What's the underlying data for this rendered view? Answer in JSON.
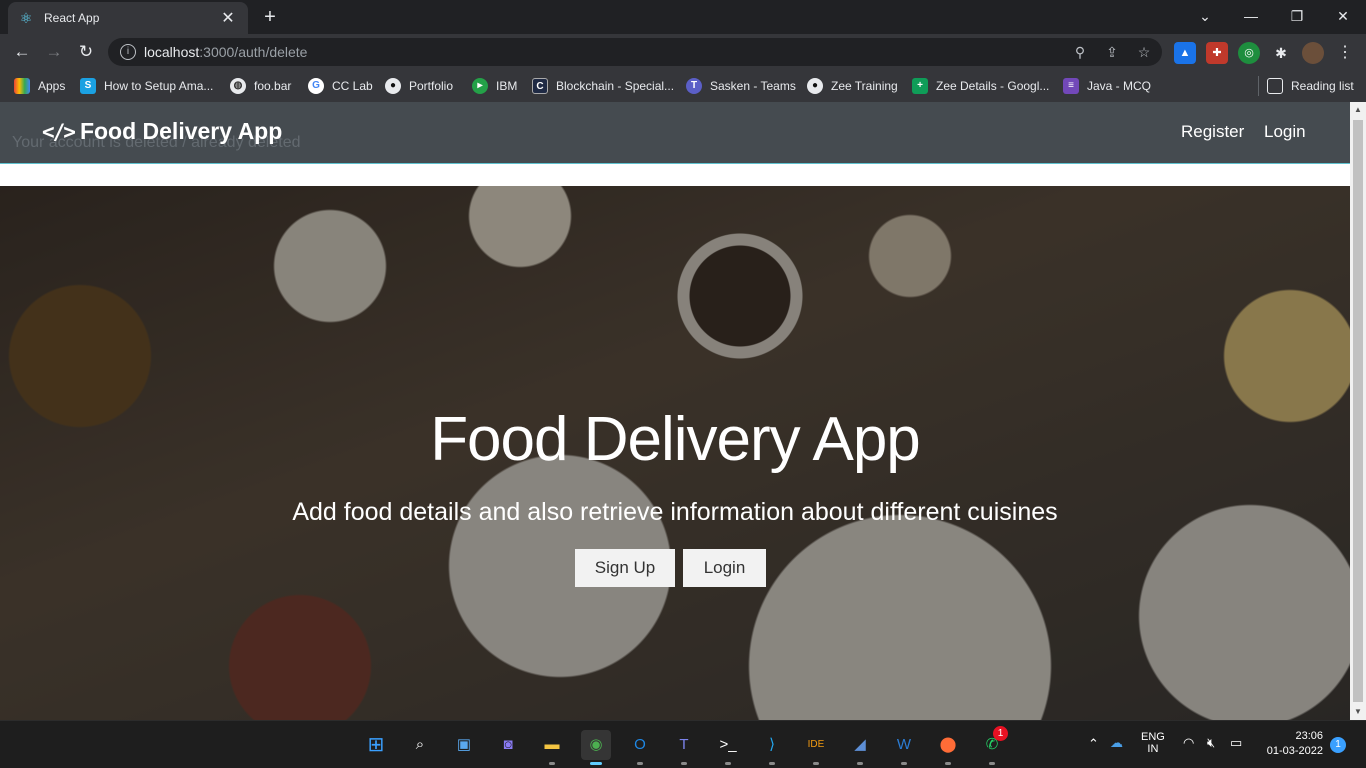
{
  "browser": {
    "tab_title": "React App",
    "url_host": "localhost",
    "url_path": ":3000/auth/delete",
    "bookmarks": [
      {
        "label": "Apps",
        "icon": "apps-grid-icon"
      },
      {
        "label": "How to Setup Ama...",
        "icon": "s-icon"
      },
      {
        "label": "foo.bar",
        "icon": "globe-icon"
      },
      {
        "label": "CC Lab",
        "icon": "google-icon"
      },
      {
        "label": "Portfolio",
        "icon": "github-icon"
      },
      {
        "label": "IBM",
        "icon": "ibm-icon"
      },
      {
        "label": "Blockchain - Special...",
        "icon": "blockchain-icon"
      },
      {
        "label": "Sasken - Teams",
        "icon": "teams-icon"
      },
      {
        "label": "Zee Training",
        "icon": "github-icon"
      },
      {
        "label": "Zee Details - Googl...",
        "icon": "sheets-icon"
      },
      {
        "label": "Java - MCQ",
        "icon": "forms-icon"
      }
    ],
    "reading_list": "Reading list"
  },
  "app": {
    "brand": "Food Delivery App",
    "nav_register": "Register",
    "nav_login": "Login",
    "ghost_message": "Your account is deleted / already deleted",
    "hero_title": "Food Delivery App",
    "hero_subtitle": "Add food details and also retrieve information about different cuisines",
    "btn_signup": "Sign Up",
    "btn_login": "Login"
  },
  "taskbar": {
    "lang": "ENG",
    "region": "IN",
    "time": "23:06",
    "date": "01-03-2022",
    "notification_count": "1",
    "whatsapp_badge": "1"
  },
  "colors": {
    "navbar": "#454b50",
    "accent_line": "#5fc2cf",
    "chrome_dark": "#202124",
    "chrome_toolbar": "#35363a"
  }
}
